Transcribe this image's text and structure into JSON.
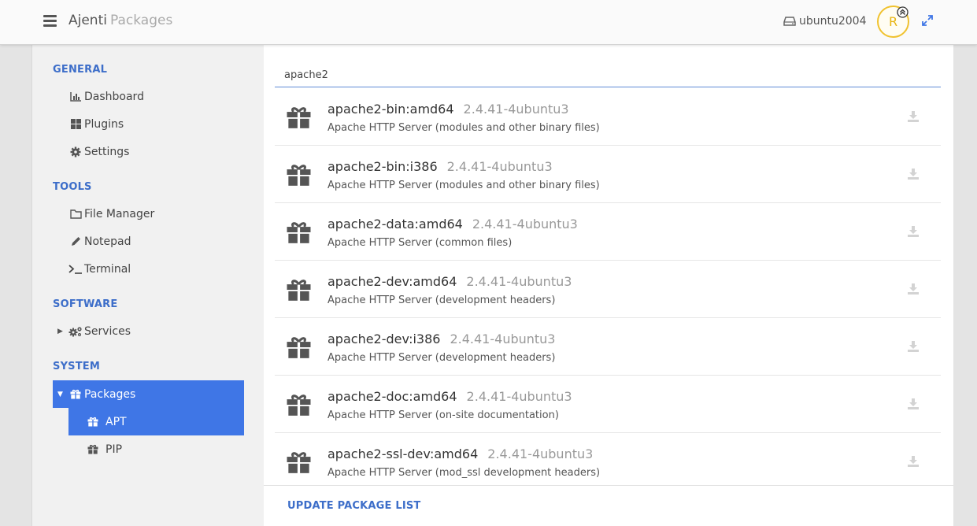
{
  "header": {
    "app_name": "Ajenti",
    "section": "Packages",
    "hostname": "ubuntu2004",
    "avatar_letter": "R"
  },
  "sidebar": {
    "sections": [
      {
        "title": "GENERAL"
      },
      {
        "title": "TOOLS"
      },
      {
        "title": "SOFTWARE"
      },
      {
        "title": "SYSTEM"
      }
    ],
    "items": {
      "dashboard": "Dashboard",
      "plugins": "Plugins",
      "settings": "Settings",
      "file_manager": "File Manager",
      "notepad": "Notepad",
      "terminal": "Terminal",
      "services": "Services",
      "packages": "Packages",
      "apt": "APT",
      "pip": "PIP"
    }
  },
  "search": {
    "value": "apache2"
  },
  "packages": [
    {
      "name": "apache2-bin:amd64",
      "version": "2.4.41-4ubuntu3",
      "description": "Apache HTTP Server (modules and other binary files)"
    },
    {
      "name": "apache2-bin:i386",
      "version": "2.4.41-4ubuntu3",
      "description": "Apache HTTP Server (modules and other binary files)"
    },
    {
      "name": "apache2-data:amd64",
      "version": "2.4.41-4ubuntu3",
      "description": "Apache HTTP Server (common files)"
    },
    {
      "name": "apache2-dev:amd64",
      "version": "2.4.41-4ubuntu3",
      "description": "Apache HTTP Server (development headers)"
    },
    {
      "name": "apache2-dev:i386",
      "version": "2.4.41-4ubuntu3",
      "description": "Apache HTTP Server (development headers)"
    },
    {
      "name": "apache2-doc:amd64",
      "version": "2.4.41-4ubuntu3",
      "description": "Apache HTTP Server (on-site documentation)"
    },
    {
      "name": "apache2-ssl-dev:amd64",
      "version": "2.4.41-4ubuntu3",
      "description": "Apache HTTP Server (mod_ssl development headers)"
    }
  ],
  "footer": {
    "update_label": "UPDATE PACKAGE LIST"
  },
  "colors": {
    "accent": "#3f76e6",
    "section_heading": "#3d6ec9",
    "avatar_ring": "#f0c22f"
  }
}
